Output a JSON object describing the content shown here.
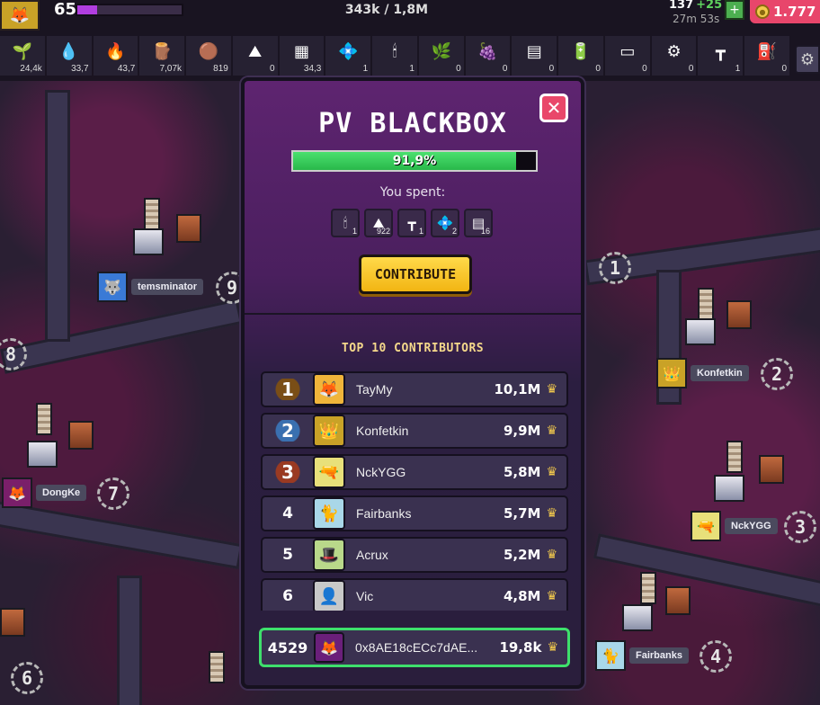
{
  "hud": {
    "level": "65",
    "xp_progress": 0.19,
    "xp_text": "343k / 1,8M",
    "energy": "137",
    "energy_plus": "+25",
    "timer": "27m 53s",
    "coins": "1.777"
  },
  "resources": [
    {
      "icon": "plant-icon",
      "glyph": "🌱",
      "value": "24,4k"
    },
    {
      "icon": "water-icon",
      "glyph": "💧",
      "value": "33,7"
    },
    {
      "icon": "fire-icon",
      "glyph": "🔥",
      "value": "43,7"
    },
    {
      "icon": "wood-icon",
      "glyph": "🪵",
      "value": "7,07k"
    },
    {
      "icon": "clay-icon",
      "glyph": "🟤",
      "value": "819"
    },
    {
      "icon": "sand-icon",
      "glyph": "⛰",
      "value": "0"
    },
    {
      "icon": "plank-icon",
      "glyph": "▦",
      "value": "34,3"
    },
    {
      "icon": "crystal-icon",
      "glyph": "💠",
      "value": "1"
    },
    {
      "icon": "matches-icon",
      "glyph": "🕯",
      "value": "1"
    },
    {
      "icon": "herb-icon",
      "glyph": "🌿",
      "value": "0"
    },
    {
      "icon": "berries-icon",
      "glyph": "🍇",
      "value": "0"
    },
    {
      "icon": "steel-plate-icon",
      "glyph": "▤",
      "value": "0"
    },
    {
      "icon": "battery-icon",
      "glyph": "🔋",
      "value": "0"
    },
    {
      "icon": "panel-icon",
      "glyph": "▭",
      "value": "0"
    },
    {
      "icon": "machine-icon",
      "glyph": "⚙",
      "value": "0"
    },
    {
      "icon": "nail-icon",
      "glyph": "┳",
      "value": "1"
    },
    {
      "icon": "canister-icon",
      "glyph": "⛽",
      "value": "0"
    }
  ],
  "map_players": [
    {
      "name": "temsminator",
      "rank": "9"
    },
    {
      "name": "Konfetkin",
      "rank": "2"
    },
    {
      "name": "DongKe",
      "rank": "7"
    },
    {
      "name": "NckYGG",
      "rank": "3"
    },
    {
      "name": "Fairbanks",
      "rank": "4"
    }
  ],
  "map_ranks": {
    "left_8": "8",
    "right_1": "1",
    "bottom_6": "6"
  },
  "modal": {
    "title": "PV BLACKBOX",
    "progress": 0.919,
    "progress_text": "91,9%",
    "spent_label": "You spent:",
    "spent": [
      {
        "icon": "matches-icon",
        "glyph": "🕯",
        "value": "1"
      },
      {
        "icon": "sand-icon",
        "glyph": "⛰",
        "value": "922"
      },
      {
        "icon": "nail-icon",
        "glyph": "┳",
        "value": "1"
      },
      {
        "icon": "crystal-icon",
        "glyph": "💠",
        "value": "2"
      },
      {
        "icon": "steel-plate-icon",
        "glyph": "▤",
        "value": "16"
      }
    ],
    "contribute_label": "CONTRIBUTE",
    "top_title": "TOP 10 CONTRIBUTORS",
    "contributors": [
      {
        "rank": "1",
        "name": "TayMy",
        "value": "10,1M",
        "avatar_color": "#f0b53a"
      },
      {
        "rank": "2",
        "name": "Konfetkin",
        "value": "9,9M",
        "avatar_color": "#c9a227"
      },
      {
        "rank": "3",
        "name": "NckYGG",
        "value": "5,8M",
        "avatar_color": "#e8e07a"
      },
      {
        "rank": "4",
        "name": "Fairbanks",
        "value": "5,7M",
        "avatar_color": "#a9d7e8"
      },
      {
        "rank": "5",
        "name": "Acrux",
        "value": "5,2M",
        "avatar_color": "#b9d88a"
      },
      {
        "rank": "6",
        "name": "Vic",
        "value": "4,8M",
        "avatar_color": "#c8c8c8"
      }
    ],
    "me": {
      "rank": "4529",
      "name": "0x8AE18cECc7dAE...",
      "value": "19,8k"
    }
  },
  "colors": {
    "accent_green": "#3ee06c",
    "contribute_yellow": "#f2b513",
    "close_pink": "#e9476a",
    "coins_pink": "#e8466b",
    "xp_purple": "#b13ee0"
  }
}
